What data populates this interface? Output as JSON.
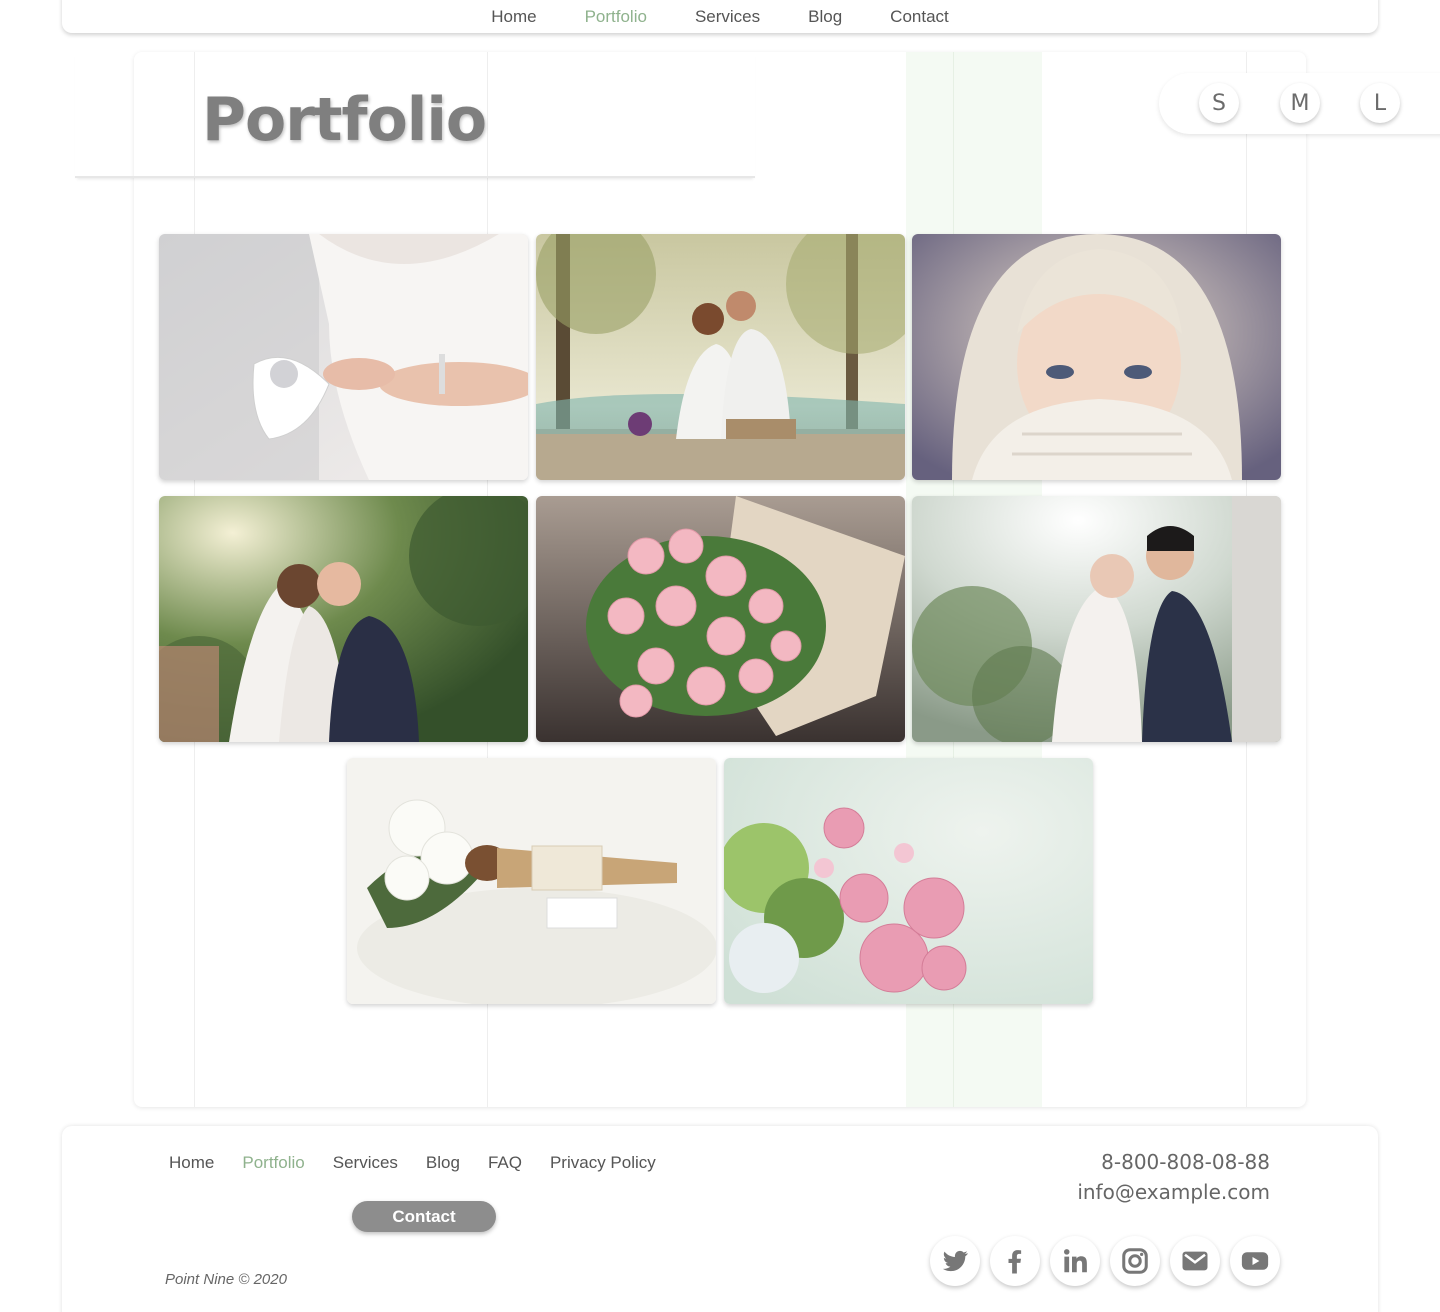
{
  "nav": {
    "items": [
      {
        "label": "Home",
        "active": false
      },
      {
        "label": "Portfolio",
        "active": true
      },
      {
        "label": "Services",
        "active": false
      },
      {
        "label": "Blog",
        "active": false
      },
      {
        "label": "Contact",
        "active": false
      }
    ]
  },
  "page": {
    "title": "Portfolio"
  },
  "size_switch": {
    "small": "S",
    "medium": "M",
    "large": "L"
  },
  "gallery": {
    "photos": [
      {
        "subject": "bride in sparkling dress holding jeweled shoe"
      },
      {
        "subject": "couple sitting on wooden deck in forest"
      },
      {
        "subject": "blonde woman covering face with knit sweater"
      },
      {
        "subject": "bride and groom embracing among trees"
      },
      {
        "subject": "bouquet of pink roses wrapped in paper"
      },
      {
        "subject": "couple kissing in sunlit greenhouse"
      },
      {
        "subject": "white flower bouquet with pine cone and lace"
      },
      {
        "subject": "pink rose and green hydrangea bouquet"
      }
    ]
  },
  "footer": {
    "nav": [
      {
        "label": "Home",
        "active": false
      },
      {
        "label": "Portfolio",
        "active": true
      },
      {
        "label": "Services",
        "active": false
      },
      {
        "label": "Blog",
        "active": false
      },
      {
        "label": "FAQ",
        "active": false
      },
      {
        "label": "Privacy Policy",
        "active": false
      }
    ],
    "contact_button": "Contact",
    "copyright": "Point Nine © 2020",
    "phone": "8-800-808-08-88",
    "email": "info@example.com",
    "social": [
      "twitter-icon",
      "facebook-icon",
      "linkedin-icon",
      "instagram-icon",
      "mail-icon",
      "youtube-icon"
    ]
  },
  "colors": {
    "accent": "#8fb28d",
    "text": "#555555",
    "button": "#8d8d8d",
    "stripe": "#f4faf3"
  }
}
